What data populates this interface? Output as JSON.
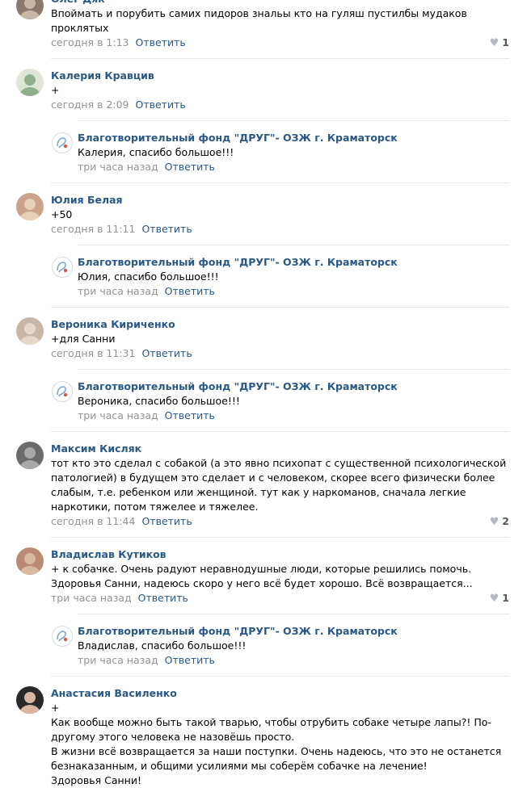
{
  "comments": [
    {
      "author": "Олег Дяк",
      "text": [
        "Впоймать и порубить самих пидоров знальы кто на гуляш пустилбы мудаков проклятых"
      ],
      "time": "сегодня в 1:13",
      "reply_label": "Ответить",
      "likes": "1",
      "avatar_icon": "user-avatar",
      "replies": []
    },
    {
      "author": "Калерия Кравцив",
      "text": [
        "+"
      ],
      "time": "сегодня в 2:09",
      "reply_label": "Ответить",
      "likes": "",
      "avatar_icon": "user-avatar",
      "replies": [
        {
          "author": "Благотворительный фонд \"ДРУГ\"- ОЗЖ г. Краматорск",
          "text": "Калерия, спасибо большое!!!",
          "time": "три часа назад",
          "reply_label": "Ответить"
        }
      ]
    },
    {
      "author": "Юлия Белая",
      "text": [
        "+50"
      ],
      "time": "сегодня в 11:11",
      "reply_label": "Ответить",
      "likes": "",
      "avatar_icon": "user-avatar",
      "replies": [
        {
          "author": "Благотворительный фонд \"ДРУГ\"- ОЗЖ г. Краматорск",
          "text": "Юлия, спасибо большое!!!",
          "time": "три часа назад",
          "reply_label": "Ответить"
        }
      ]
    },
    {
      "author": "Вероника Кириченко",
      "text": [
        "+для Санни"
      ],
      "time": "сегодня в 11:31",
      "reply_label": "Ответить",
      "likes": "",
      "avatar_icon": "user-avatar",
      "replies": [
        {
          "author": "Благотворительный фонд \"ДРУГ\"- ОЗЖ г. Краматорск",
          "text": "Вероника, спасибо большое!!!",
          "time": "три часа назад",
          "reply_label": "Ответить"
        }
      ]
    },
    {
      "author": "Максим Кисляк",
      "text": [
        "тот кто это сделал с собакой (а это явно психопат с существенной психологической патологией) в будущем это сделает и с человеком, скорее всего физически более слабым, т.е. ребенком или женщиной. тут как у наркоманов, сначала легкие наркотики, потом тяжелее и тяжелее."
      ],
      "time": "сегодня в 11:44",
      "reply_label": "Ответить",
      "likes": "2",
      "avatar_icon": "user-avatar",
      "replies": []
    },
    {
      "author": "Владислав Кутиков",
      "text": [
        "+ к собачке. Очень радуют неравнодушные люди, которые решились помочь. Здоровья Санни, надеюсь скоро у него всё будет хорошо. Всё возвращается..."
      ],
      "time": "три часа назад",
      "reply_label": "Ответить",
      "likes": "1",
      "avatar_icon": "user-avatar",
      "replies": [
        {
          "author": "Благотворительный фонд \"ДРУГ\"- ОЗЖ г. Краматорск",
          "text": "Владислав, спасибо большое!!!",
          "time": "три часа назад",
          "reply_label": "Ответить"
        }
      ]
    },
    {
      "author": "Анастасия Василенко",
      "text": [
        "+",
        "Как вообще можно быть такой тварью, чтобы отрубить собаке четыре лапы?! По-другому этого человека не назовёшь просто.",
        "В жизни всё возвращается за наши поступки. Очень надеюсь, что это не останется безнаказанным, и общими усилиями мы соберём собачке на лечение!",
        "Здоровья Санни!"
      ],
      "time": "",
      "reply_label": "",
      "likes": "",
      "avatar_icon": "user-avatar",
      "replies": []
    }
  ],
  "colors": {
    "link": "#2a5885",
    "meta": "#939393",
    "separator": "#e7e8ec",
    "heart": "#b5b9c0"
  },
  "avatars": [
    {
      "bg": "#8a7a6e",
      "fg": "#c9b7a6"
    },
    {
      "bg": "#dfe6d6",
      "fg": "#8fb08a"
    },
    {
      "bg": "#c9a48a",
      "fg": "#e8cfb8"
    },
    {
      "bg": "#c7b7a6",
      "fg": "#e6d8c8"
    },
    {
      "bg": "#6b6b6b",
      "fg": "#a8a8a8"
    },
    {
      "bg": "#b98a74",
      "fg": "#d9b8a2"
    },
    {
      "bg": "#2a2a2a",
      "fg": "#d8b6a0"
    }
  ]
}
